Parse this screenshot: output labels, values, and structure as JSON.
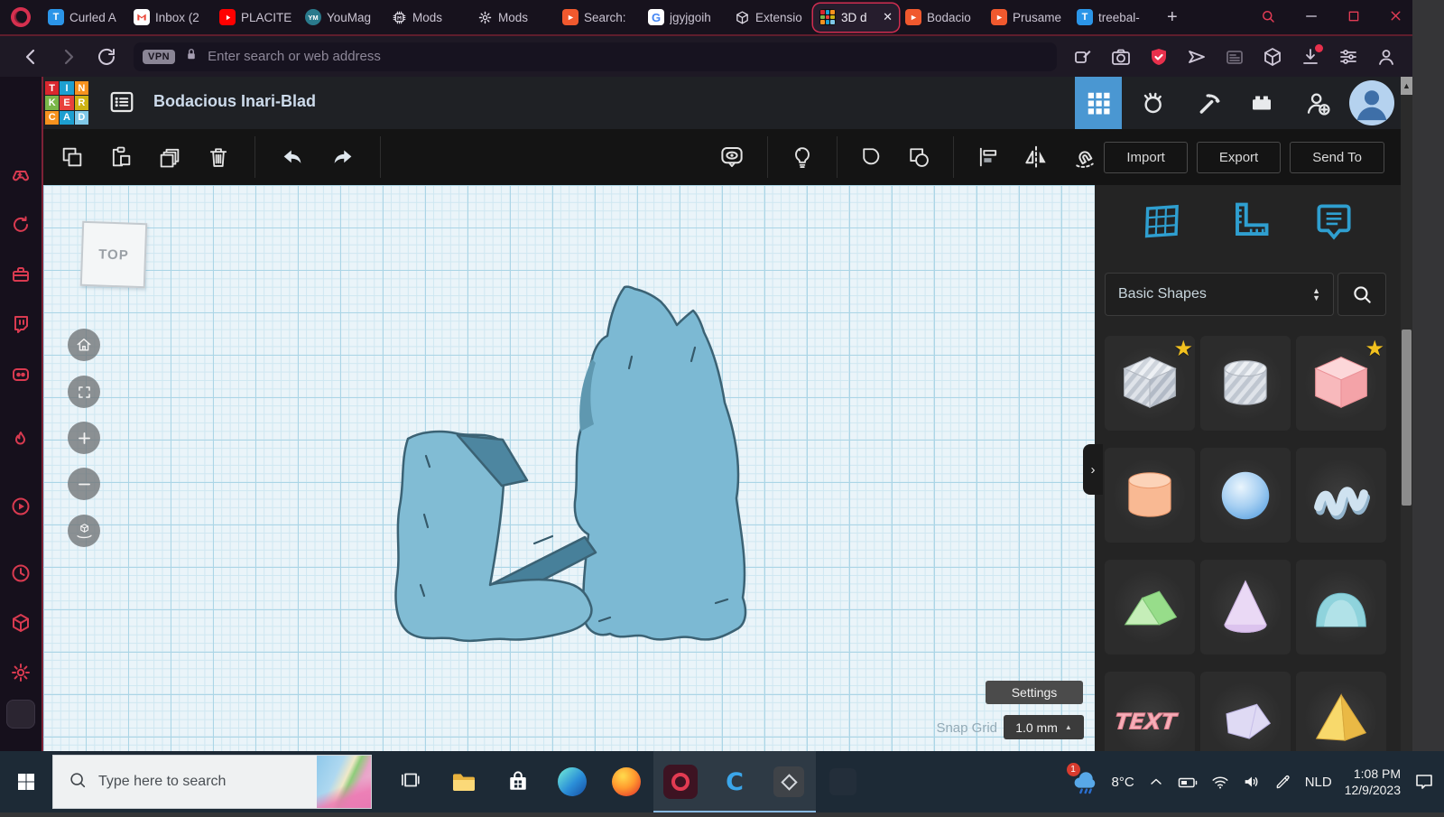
{
  "colors": {
    "accent_red": "#d6304f",
    "tinkercad_blue": "#4a97d2",
    "panel_icon_blue": "#2f9fd0",
    "model_fill": "#7cb9d3",
    "canvas_bg": "#eaf4f9"
  },
  "tab_bar": {
    "tabs": [
      {
        "label": "Curled A",
        "icon": "t-blue"
      },
      {
        "label": "Inbox (2",
        "icon": "gmail"
      },
      {
        "label": "PLACITE",
        "icon": "youtube"
      },
      {
        "label": "YouMag",
        "icon": "youmag",
        "icon_text": "YM"
      },
      {
        "label": "Mods",
        "icon": "chip"
      },
      {
        "label": "Mods",
        "icon": "gear"
      },
      {
        "label": "Search:",
        "icon": "prusa"
      },
      {
        "label": "jgyjgoih",
        "icon": "google"
      },
      {
        "label": "Extensio",
        "icon": "cube"
      },
      {
        "label": "3D d",
        "icon": "tinkercad",
        "active": true,
        "closable": true
      },
      {
        "label": "Bodacio",
        "icon": "prusa"
      },
      {
        "label": "Prusame",
        "icon": "prusa"
      },
      {
        "label": "treebal-",
        "icon": "t-blue"
      }
    ],
    "new_tab_label": "+",
    "window_controls": [
      "search",
      "minimize",
      "maximize",
      "close"
    ]
  },
  "browser_toolbar": {
    "nav_icons": [
      "back",
      "forward",
      "reload"
    ],
    "vpn_badge": "VPN",
    "address_placeholder": "Enter search or web address",
    "action_icons": [
      "pin",
      "camera",
      "shield",
      "send",
      "reader",
      "cube",
      "download",
      "tune",
      "person"
    ]
  },
  "gx_sidebar": {
    "icons": [
      "gx-corner",
      "refresh",
      "toolbox",
      "twitch",
      "discord",
      "flame",
      "player",
      "history",
      "cube3d",
      "gear",
      "pinned-site",
      "gallery",
      "more"
    ]
  },
  "app_header": {
    "logo_tiles": [
      {
        "letter": "T",
        "color": "#d9272e"
      },
      {
        "letter": "I",
        "color": "#1d9fd0"
      },
      {
        "letter": "N",
        "color": "#f6921e"
      },
      {
        "letter": "K",
        "color": "#7ab648"
      },
      {
        "letter": "E",
        "color": "#e8413c"
      },
      {
        "letter": "R",
        "color": "#cdb213"
      },
      {
        "letter": "C",
        "color": "#f6921e"
      },
      {
        "letter": "A",
        "color": "#1d9fd0"
      },
      {
        "letter": "D",
        "color": "#7fc8e8"
      }
    ],
    "title": "Bodacious Inari-Blad",
    "right_icons": [
      {
        "name": "grid9",
        "active": true
      },
      {
        "name": "paw"
      },
      {
        "name": "pickaxe"
      },
      {
        "name": "brick"
      },
      {
        "name": "invite"
      }
    ]
  },
  "edit_toolbar": {
    "left_icons": [
      "copy",
      "paste",
      "duplicate",
      "delete",
      "sep",
      "undo",
      "redo",
      "sep"
    ],
    "right_icons": [
      "show-all",
      "sep",
      "light",
      "sep",
      "solid",
      "hole",
      "sep",
      "align",
      "mirror",
      "magnet"
    ],
    "buttons": [
      {
        "label": "Import"
      },
      {
        "label": "Export"
      },
      {
        "label": "Send To"
      }
    ]
  },
  "canvas": {
    "view_cube_label": "TOP",
    "view_controls": [
      "home",
      "fit",
      "zoom-in",
      "zoom-out",
      "perspective"
    ],
    "settings_button": "Settings",
    "snap_grid_label": "Snap Grid",
    "snap_grid_value": "1.0 mm",
    "panel_collapse": "›"
  },
  "shapes_panel": {
    "tool_icons": [
      "workplane",
      "ruler",
      "notes"
    ],
    "category_selector": "Basic Shapes",
    "shapes": [
      {
        "name": "box-hole",
        "starred": true
      },
      {
        "name": "cylinder-hole"
      },
      {
        "name": "box",
        "starred": true
      },
      {
        "name": "cylinder"
      },
      {
        "name": "sphere"
      },
      {
        "name": "scribble"
      },
      {
        "name": "roof"
      },
      {
        "name": "cone"
      },
      {
        "name": "round-roof"
      },
      {
        "name": "text",
        "label": "TEXT"
      },
      {
        "name": "polygon"
      },
      {
        "name": "pyramid"
      }
    ]
  },
  "taskbar": {
    "search_placeholder": "Type here to search",
    "apps": [
      {
        "name": "task-view"
      },
      {
        "name": "file-explorer"
      },
      {
        "name": "ms-store"
      },
      {
        "name": "edge"
      },
      {
        "name": "firefox"
      },
      {
        "name": "opera-gx",
        "active": true
      },
      {
        "name": "cura",
        "active": true
      },
      {
        "name": "studio",
        "active": true
      },
      {
        "name": "hidden-app"
      }
    ],
    "tray": {
      "badge": "1",
      "temperature": "8°C",
      "icons": [
        "chevron-up",
        "battery",
        "wifi",
        "volume",
        "pen"
      ],
      "language": "NLD",
      "time": "1:08 PM",
      "date": "12/9/2023"
    }
  }
}
